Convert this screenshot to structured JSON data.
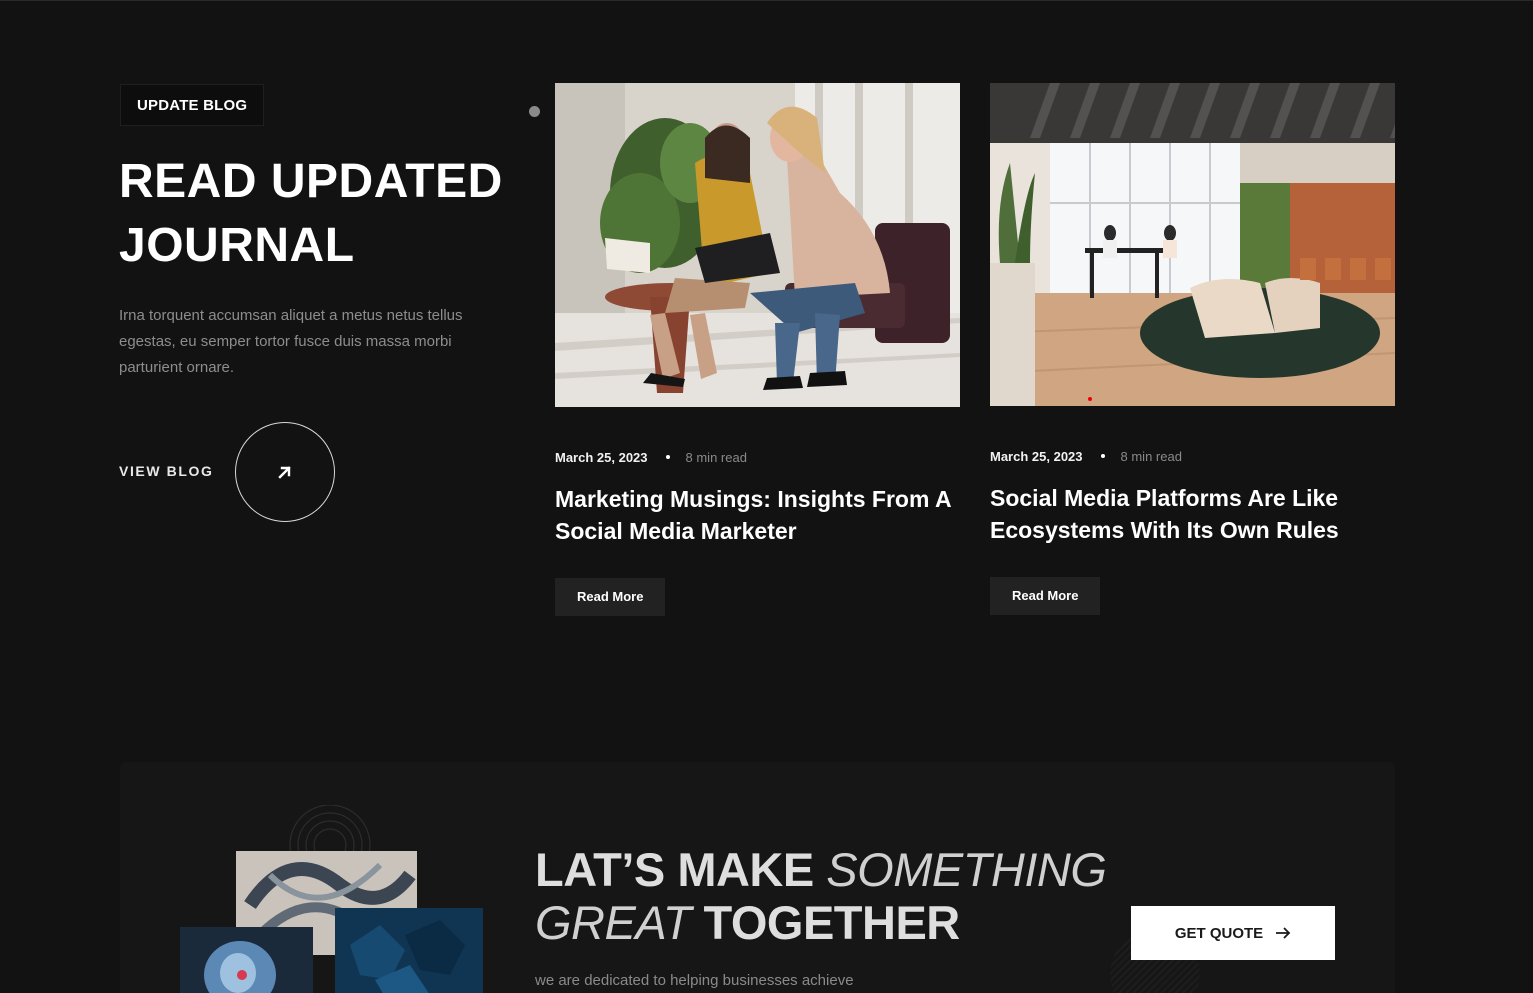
{
  "section": {
    "tag": "UPDATE BLOG",
    "heading_line1": "READ UPDATED",
    "heading_line2": "JOURNAL",
    "description": "Irna torquent accumsan aliquet a metus netus tellus egestas, eu semper tortor fusce duis massa morbi parturient ornare.",
    "view_blog": "VIEW BLOG"
  },
  "posts": [
    {
      "date": "March 25, 2023",
      "read_time": "8 min read",
      "title": "Marketing Musings: Insights From A Social Media Marketer",
      "button": "Read More"
    },
    {
      "date": "March 25, 2023",
      "read_time": "8 min read",
      "title": "Social Media Platforms Are Like Ecosystems With Its Own Rules",
      "button": "Read More"
    }
  ],
  "cta": {
    "title_bold_1": "LAT’S MAKE ",
    "title_italic_1": "SOMETHING",
    "title_italic_2": "GREAT ",
    "title_bold_2": "TOGETHER",
    "subtitle": "we are dedicated to helping businesses achieve",
    "button": "GET QUOTE"
  },
  "icons": {
    "view_blog_arrow": "arrow-up-right-icon",
    "quote_arrow": "arrow-right-icon"
  },
  "colors": {
    "background": "#121212",
    "cta_background": "#161616",
    "button_dark": "#222222",
    "button_light": "#ffffff",
    "muted_text": "#8d8d8d"
  }
}
